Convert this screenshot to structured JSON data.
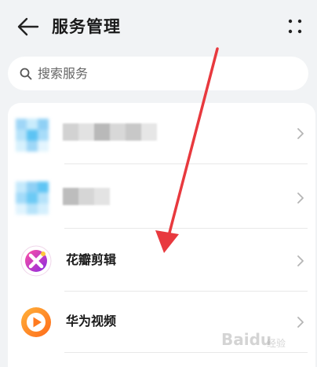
{
  "header": {
    "title": "服务管理",
    "back_icon": "arrow-left-icon",
    "more_icon": "four-dots-icon"
  },
  "search": {
    "placeholder": "搜索服务",
    "value": ""
  },
  "services": [
    {
      "name": "",
      "icon": "blurred-icon"
    },
    {
      "name": "",
      "icon": "blurred-icon"
    },
    {
      "name": "花瓣剪辑",
      "icon": "petal-clip-icon"
    },
    {
      "name": "华为视频",
      "icon": "huawei-video-icon"
    }
  ],
  "annotation": {
    "arrow_color": "#e8393e"
  },
  "watermark": {
    "text": "Baidu",
    "sub": "经验"
  },
  "colors": {
    "background": "#f1f3f5",
    "card": "#ffffff",
    "arrow": "#e8393e"
  }
}
